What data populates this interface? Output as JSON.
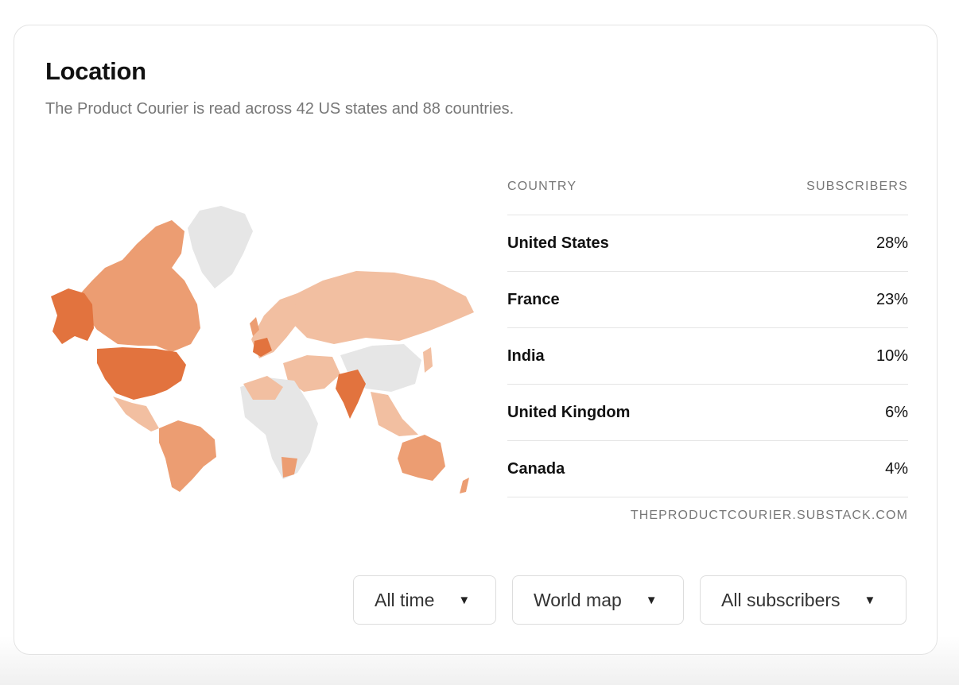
{
  "location": {
    "title": "Location",
    "subtitle": "The Product Courier is read across 42 US states and 88 countries.",
    "table": {
      "headers": {
        "country": "COUNTRY",
        "subscribers": "SUBSCRIBERS"
      },
      "rows": [
        {
          "country": "United States",
          "pct": "28%"
        },
        {
          "country": "France",
          "pct": "23%"
        },
        {
          "country": "India",
          "pct": "10%"
        },
        {
          "country": "United Kingdom",
          "pct": "6%"
        },
        {
          "country": "Canada",
          "pct": "4%"
        }
      ],
      "source": "THEPRODUCTCOURIER.SUBSTACK.COM"
    },
    "controls": {
      "time": "All time",
      "view": "World map",
      "audience": "All subscribers"
    },
    "map_colors": {
      "none": "#e6e6e6",
      "low": "#f2bfa1",
      "mid": "#ec9d72",
      "high": "#e2733e"
    }
  }
}
